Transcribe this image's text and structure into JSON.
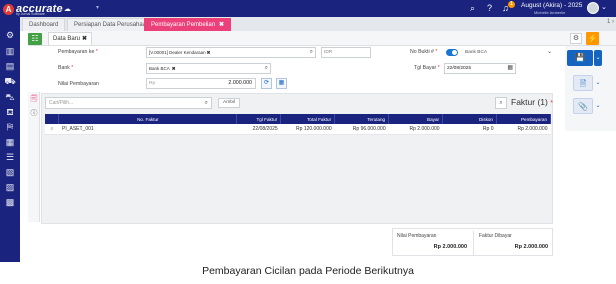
{
  "app": {
    "logo_text": "accurate",
    "logo_sub": "by Jurnal Software",
    "user_name": "August (Akira) - 2025",
    "user_sub": "Michelle Amberlie",
    "notif_count": "1",
    "window_indicator": "1 ›"
  },
  "tabs": [
    {
      "label": "Dashboard"
    },
    {
      "label": "Persiapan Data Perusahaan"
    },
    {
      "label": "Pembayaran Pembelian",
      "close": "✖"
    }
  ],
  "subbar": {
    "data_tab_label": "Data Baru",
    "data_tab_close": "✖"
  },
  "form": {
    "pembayaran_ke_label": "Pembayaran ke",
    "pembayaran_ke_value": "[V.00001] Dealer Kendaraan",
    "pembayaran_ke_close": "✖",
    "currency": "IDR",
    "bank_label": "Bank",
    "bank_value": "Bank BCA",
    "bank_close": "✖",
    "nilai_label": "Nilai Pembayaran",
    "nilai_prefix": "Rp",
    "nilai_value": "2.000.000",
    "no_bukti_label": "No Bukti #",
    "no_bukti_value": "Bank BCA",
    "tgl_bayar_label": "Tgl Bayar",
    "tgl_bayar_value": "22/08/2025",
    "required_mark": "*"
  },
  "detail": {
    "search_placeholder": "Cari/Pilih...",
    "ambil_label": "Ambil",
    "faktur_title": "Faktur (1)",
    "columns": [
      "No. Faktur",
      "Tgl Faktur",
      "Total Faktur",
      "Terutang",
      "Bayar",
      "Diskon",
      "Pembayaran"
    ],
    "rows": [
      {
        "handle": "≡",
        "no_faktur": "PI_ASET_001",
        "tgl_faktur": "22/08/2025",
        "total_faktur": "Rp 120.000.000",
        "terutang": "Rp 96.000.000",
        "bayar": "Rp 2.000.000",
        "diskon": "Rp 0",
        "pembayaran": "Rp 2.000.000"
      }
    ]
  },
  "summary": {
    "nilai_label": "Nilai Pembayaran",
    "nilai_value": "Rp 2.000.000",
    "faktur_label": "Faktur Dibayar",
    "faktur_value": "Rp 2.000.000"
  },
  "caption": "Pembayaran Cicilan pada Periode Berikutnya",
  "colors": {
    "navy": "#1a237e",
    "accent_pink": "#ec407a",
    "primary_blue": "#1565c0",
    "green": "#43a047",
    "orange": "#ff9800"
  },
  "icons": {
    "sidebar": [
      "gear-icon",
      "building-icon",
      "document-icon",
      "truck-icon",
      "cart-icon",
      "cart-in-icon",
      "cart-out-icon",
      "chart-icon",
      "list-icon",
      "report-icon",
      "grid-icon",
      "store-icon"
    ]
  }
}
